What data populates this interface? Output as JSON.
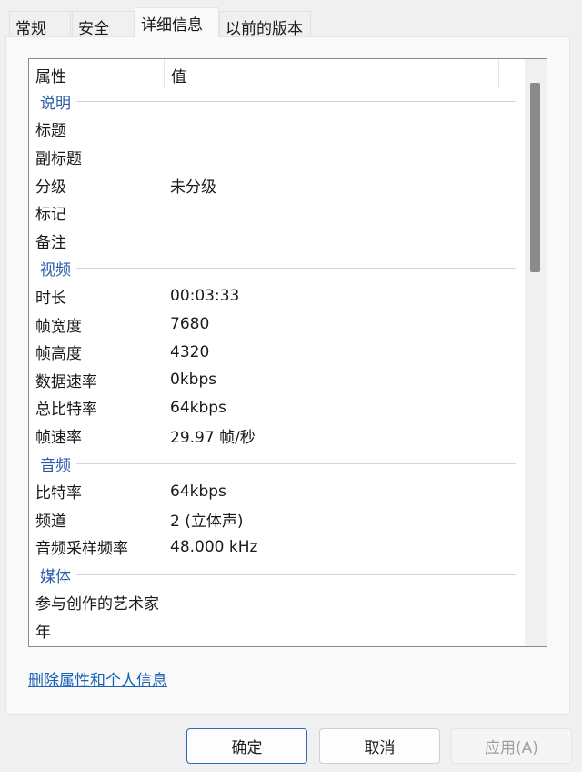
{
  "tabs": [
    "常规",
    "安全",
    "详细信息",
    "以前的版本"
  ],
  "header": {
    "property": "属性",
    "value": "值"
  },
  "groups": [
    {
      "name": "说明",
      "rows": [
        [
          "标题",
          ""
        ],
        [
          "副标题",
          ""
        ],
        [
          "分级",
          "未分级"
        ],
        [
          "标记",
          ""
        ],
        [
          "备注",
          ""
        ]
      ]
    },
    {
      "name": "视频",
      "rows": [
        [
          "时长",
          "00:03:33"
        ],
        [
          "帧宽度",
          "7680"
        ],
        [
          "帧高度",
          "4320"
        ],
        [
          "数据速率",
          "0kbps"
        ],
        [
          "总比特率",
          "64kbps"
        ],
        [
          "帧速率",
          "29.97 帧/秒"
        ]
      ]
    },
    {
      "name": "音频",
      "rows": [
        [
          "比特率",
          "64kbps"
        ],
        [
          "频道",
          "2 (立体声)"
        ],
        [
          "音频采样频率",
          "48.000 kHz"
        ]
      ]
    },
    {
      "name": "媒体",
      "rows": [
        [
          "参与创作的艺术家",
          ""
        ],
        [
          "年",
          ""
        ]
      ]
    }
  ],
  "link": "删除属性和个人信息",
  "buttons": {
    "ok": "确定",
    "cancel": "取消",
    "apply": "应用(A)"
  }
}
